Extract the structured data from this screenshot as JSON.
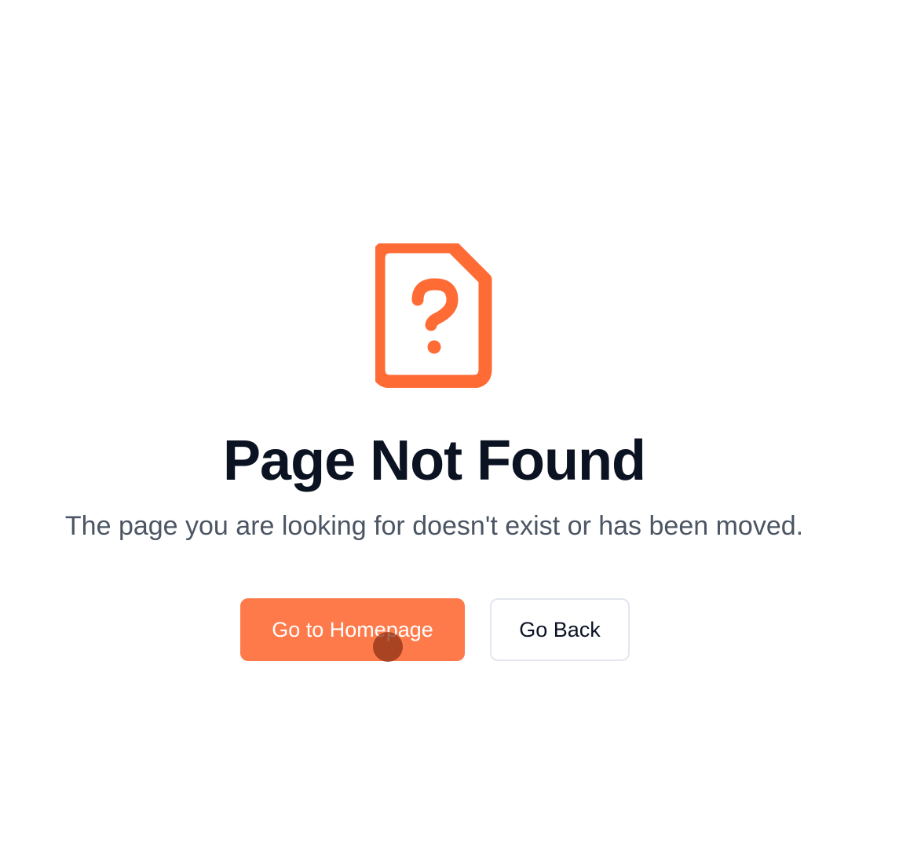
{
  "colors": {
    "accent": "#ff6b35",
    "primary_button_bg": "#ff7a4a",
    "title_text": "#0b1222",
    "subtitle_text": "#4b5563",
    "secondary_button_border": "#e3e6ee"
  },
  "icon": {
    "name": "file-question-icon"
  },
  "main": {
    "title": "Page Not Found",
    "subtitle": "The page you are looking for doesn't exist or has been moved."
  },
  "actions": {
    "home_label": "Go to Homepage",
    "back_label": "Go Back"
  }
}
